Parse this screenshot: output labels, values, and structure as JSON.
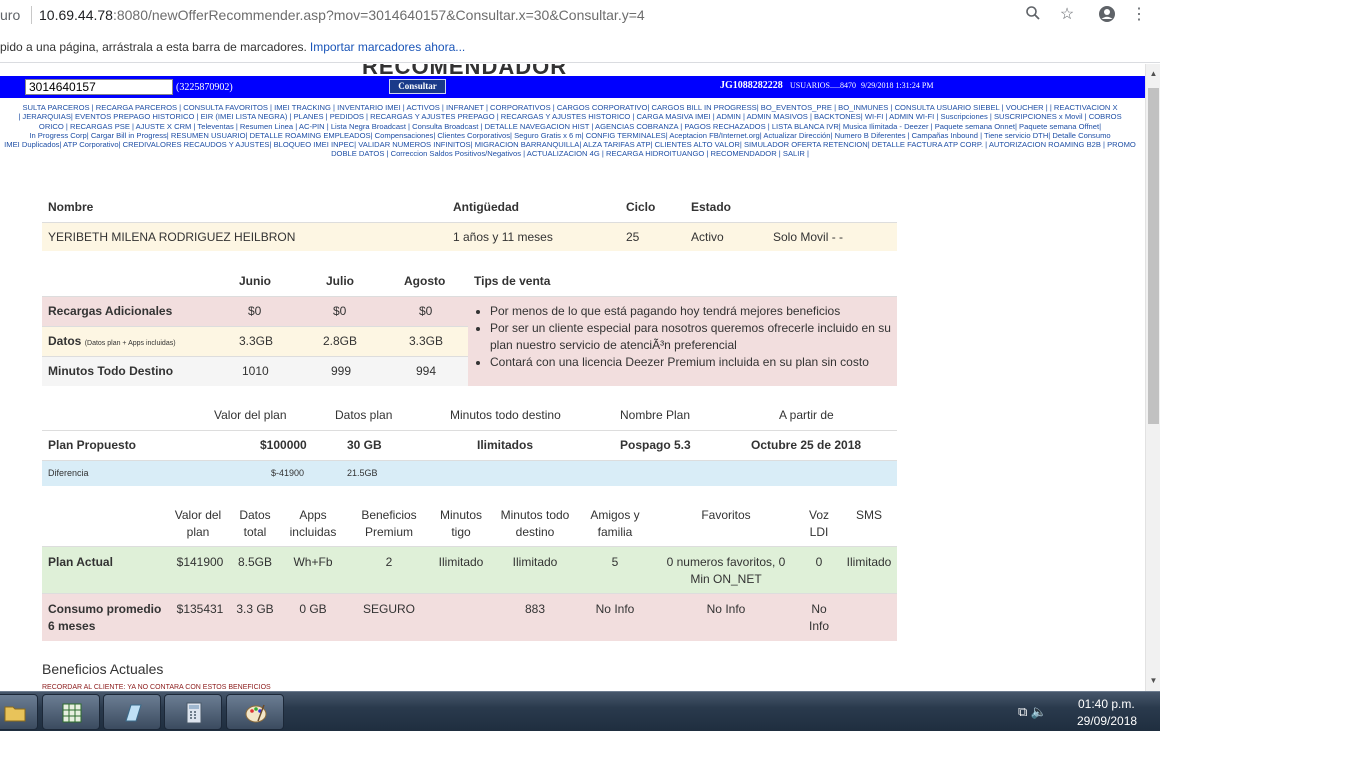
{
  "browser": {
    "secure_label": "uro",
    "url_host": "10.69.44.78",
    "url_rest": ":8080/newOfferRecommender.asp?mov=3014640157&Consultar.x=30&Consultar.y=4",
    "bookmarks_hint": "pido a una página, arrástrala a esta barra de marcadores.",
    "bookmarks_import": "Importar marcadores ahora..."
  },
  "header": {
    "title_partial": "RECOMENDADOR",
    "phone": "3014640157",
    "alt_number": "(3225870902)",
    "consultar_label": "Consultar",
    "user_id": "JG1088282228",
    "usuarios": "USUARIOS.....8470",
    "datetime": "9/29/2018 1:31:24 PM"
  },
  "nav_lines": [
    "SULTA PARCEROS | RECARGA PARCEROS | CONSULTA FAVORITOS | IMEI TRACKING | INVENTARIO IMEI | ACTIVOS | INFRANET | CORPORATIVOS | CARGOS CORPORATIVO| CARGOS BILL IN PROGRESS| BO_EVENTOS_PRE | BO_INMUNES | CONSULTA USUARIO SIEBEL | VOUCHER | | REACTIVACION X",
    "| JERARQUIAS| EVENTOS PREPAGO HISTORICO | EIR (IMEI LISTA NEGRA) | PLANES | PEDIDOS | RECARGAS Y AJUSTES PREPAGO | RECARGAS Y AJUSTES HISTORICO | CARGA MASIVA IMEI | ADMIN | ADMIN MASIVOS | BACKTONES| WI-FI | ADMIN WI-FI | Suscripciones | SUSCRIPCIONES x Movil | COBROS",
    "ORICO | RECARGAS PSE | AJUSTE X CRM | Televentas | Resumen Linea | AC-PIN | Lista Negra Broadcast | Consulta Broadcast | DETALLE NAVEGACION HIST | AGENCIAS COBRANZA | PAGOS RECHAZADOS | LISTA BLANCA IVR| Musica Ilimitada - Deezer | Paquete semana Onnet| Paquete semana Offnet|",
    "In Progress Corp| Cargar Bill in Progress| RESUMEN USUARIO| DETALLE ROAMING EMPLEADOS| Compensaciones| Clientes Corporativos| Seguro Gratis x 6 m| CONFIG TERMINALES| Aceptacion FB/Internet.org| Actualizar Dirección| Numero B Diferentes | Campañas Inbound | Tiene servicio DTH| Detalle Consumo",
    "IMEI Duplicados| ATP Corporativo| CREDIVALORES RECAUDOS Y AJUSTES| BLOQUEO IMEI INPEC| VALIDAR NUMEROS INFINITOS| MIGRACION BARRANQUILLA| ALZA TARIFAS ATP| CLIENTES ALTO VALOR| SIMULADOR OFERTA RETENCION| DETALLE FACTURA ATP CORP. | AUTORIZACION ROAMING B2B | PROMO",
    "DOBLE DATOS | Correccion Saldos Positivos/Negativos | ACTUALIZACION 4G | RECARGA HIDROITUANGO | RECOMENDADOR | SALIR |"
  ],
  "customer": {
    "headers": [
      "Nombre",
      "Antigüedad",
      "Ciclo",
      "Estado"
    ],
    "name": "YERIBETH MILENA RODRIGUEZ HEILBRON",
    "antiguedad": "1 años y 11 meses",
    "ciclo": "25",
    "estado": "Activo",
    "tipo": "Solo Movil - -"
  },
  "usage": {
    "months": [
      "Junio",
      "Julio",
      "Agosto"
    ],
    "tips_header": "Tips de venta",
    "rows": [
      {
        "label": "Recargas Adicionales",
        "note": "",
        "values": [
          "$0",
          "$0",
          "$0"
        ]
      },
      {
        "label": "Datos",
        "note": "(Datos plan + Apps incluidas)",
        "values": [
          "3.3GB",
          "2.8GB",
          "3.3GB"
        ]
      },
      {
        "label": "Minutos Todo Destino",
        "note": "",
        "values": [
          "1010",
          "999",
          "994"
        ]
      }
    ],
    "tips": [
      "Por menos de lo que está pagando hoy tendrá mejores beneficios",
      "Por ser un cliente especial para nosotros queremos ofrecerle incluido en su plan nuestro servicio de atenciÃ³n preferencial",
      "Contará con una licencia Deezer Premium incluida en su plan sin costo"
    ]
  },
  "proposed": {
    "headers": [
      "Valor del plan",
      "Datos plan",
      "Minutos todo destino",
      "Nombre Plan",
      "A partir de"
    ],
    "label": "Plan Propuesto",
    "valor": "$100000",
    "datos": "30 GB",
    "minutos": "Ilimitados",
    "nombre": "Pospago 5.3",
    "desde": "Octubre 25 de 2018",
    "diff_label": "Diferencia",
    "diff_valor": "$-41900",
    "diff_datos": "21.5GB"
  },
  "current": {
    "headers": [
      "Valor del plan",
      "Datos total",
      "Apps incluidas",
      "Beneficios Premium",
      "Minutos tigo",
      "Minutos todo destino",
      "Amigos y familia",
      "Favoritos",
      "Voz LDI",
      "SMS"
    ],
    "plan_actual": {
      "label": "Plan Actual",
      "values": [
        "$141900",
        "8.5GB",
        "Wh+Fb",
        "2",
        "Ilimitado",
        "Ilimitado",
        "5",
        "0 numeros favoritos, 0 Min ON_NET",
        "0",
        "Ilimitado"
      ]
    },
    "consumo": {
      "label": "Consumo promedio 6 meses",
      "values": [
        "$135431",
        "3.3 GB",
        "0 GB",
        "SEGURO",
        "",
        "883",
        "No Info",
        "No Info",
        "No Info",
        ""
      ]
    }
  },
  "benefits": {
    "title": "Beneficios Actuales",
    "note": "RECORDAR AL CLIENTE: YA NO CONTARA CON ESTOS BENEFICIOS"
  },
  "taskbar": {
    "apps": [
      "folder-icon",
      "spreadsheet-icon",
      "notepad-icon",
      "calculator-icon",
      "paint-icon"
    ],
    "time": "01:40 p.m.",
    "date": "29/09/2018"
  },
  "colors": {
    "header_bar": "#0000ff",
    "link": "#1f4fa5",
    "row_yellow": "#fdf6e3",
    "row_pink": "#f2dede",
    "row_blue": "#d9edf7",
    "row_green": "#dff0d8"
  }
}
